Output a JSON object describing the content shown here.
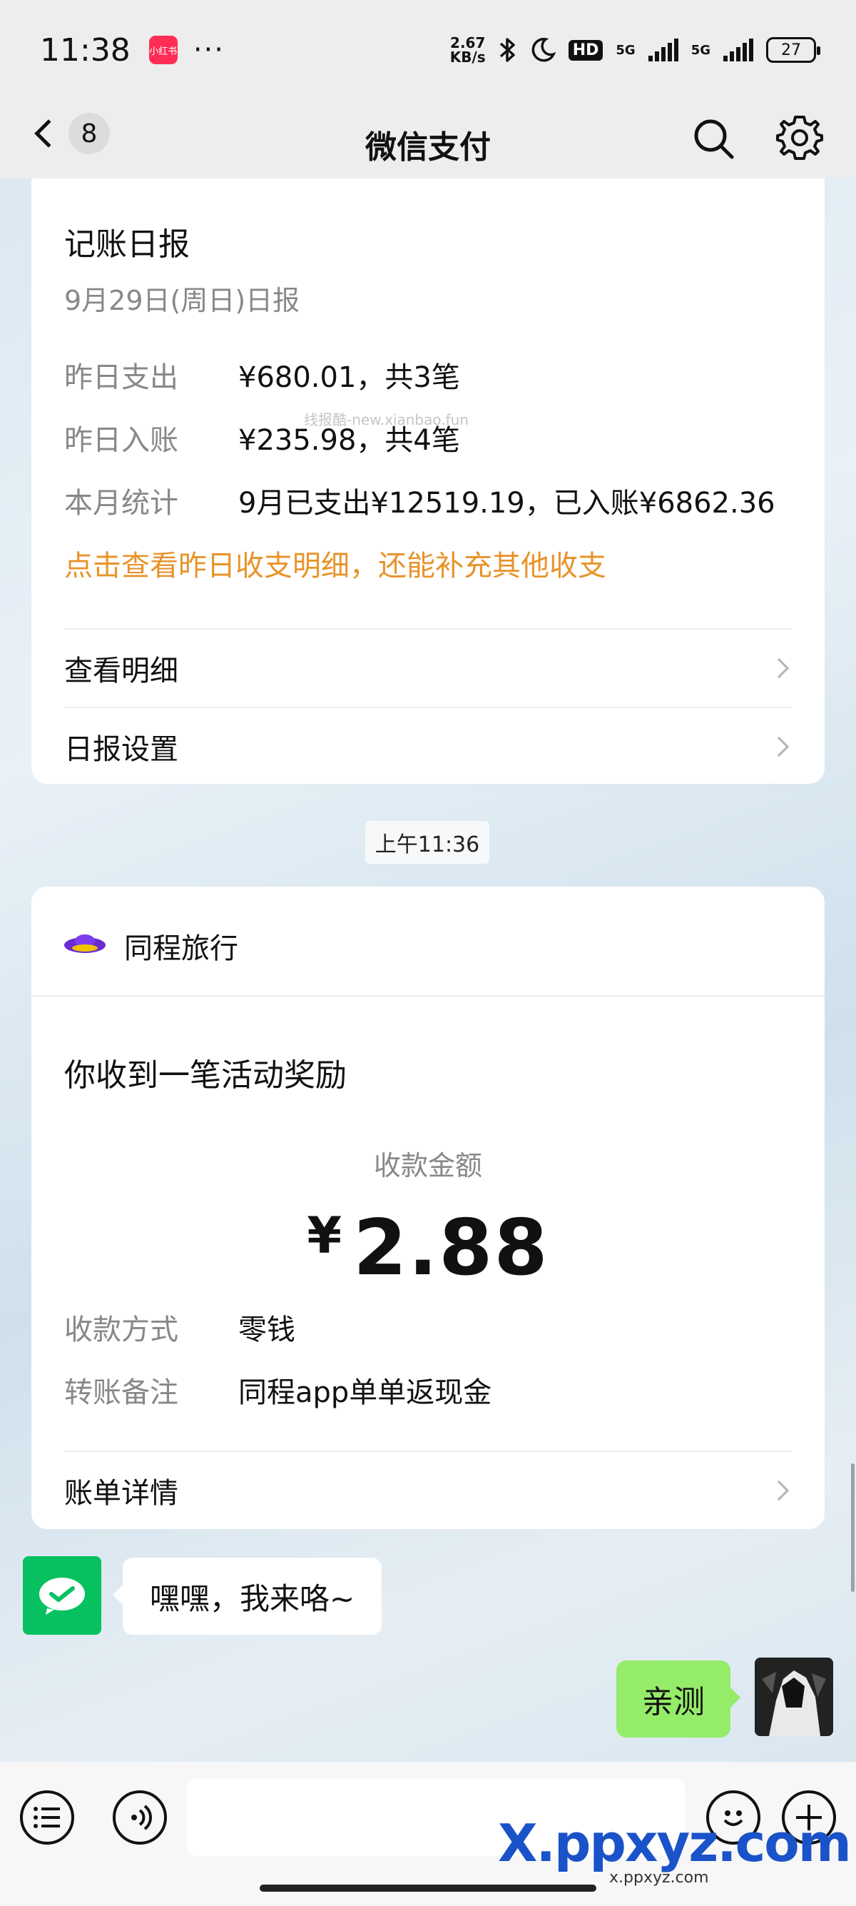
{
  "status_bar": {
    "time": "11:38",
    "app_badge": "小红书",
    "dots": "···",
    "net_speed": "2.67",
    "net_unit": "KB/s",
    "hd": "HD",
    "signal1": "5G",
    "signal2": "5G",
    "battery": "27"
  },
  "nav": {
    "back_count": "8",
    "title": "微信支付",
    "icons": [
      "back-chevron-icon",
      "search-icon",
      "gear-icon"
    ]
  },
  "daily_report": {
    "title": "记账日报",
    "subtitle": "9月29日(周日)日报",
    "rows": [
      {
        "label": "昨日支出",
        "value": "¥680.01，共3笔"
      },
      {
        "label": "昨日入账",
        "value": "¥235.98，共4笔"
      },
      {
        "label": "本月统计",
        "value": "9月已支出¥12519.19，已入账¥6862.36"
      }
    ],
    "hint": "点击查看昨日收支明细，还能补充其他收支",
    "links": [
      "查看明细",
      "日报设置"
    ],
    "inline_watermark": "线报酷-new.xianbao.fun"
  },
  "time_chip": "上午11:36",
  "payment": {
    "merchant": "同程旅行",
    "title": "你收到一笔活动奖励",
    "amount_label": "收款金额",
    "currency": "¥",
    "amount": "2.88",
    "rows": [
      {
        "label": "收款方式",
        "value": "零钱"
      },
      {
        "label": "转账备注",
        "value": "同程app单单返现金"
      }
    ],
    "link": "账单详情"
  },
  "chat": {
    "incoming": "嘿嘿，我来咯~",
    "outgoing": "亲测"
  },
  "watermark": {
    "site": "X.ppxyz.com",
    "small": "x.ppxyz.com"
  },
  "colors": {
    "accent_orange": "#e8932a",
    "wechat_green": "#07c160",
    "bubble_green": "#95ec69"
  }
}
